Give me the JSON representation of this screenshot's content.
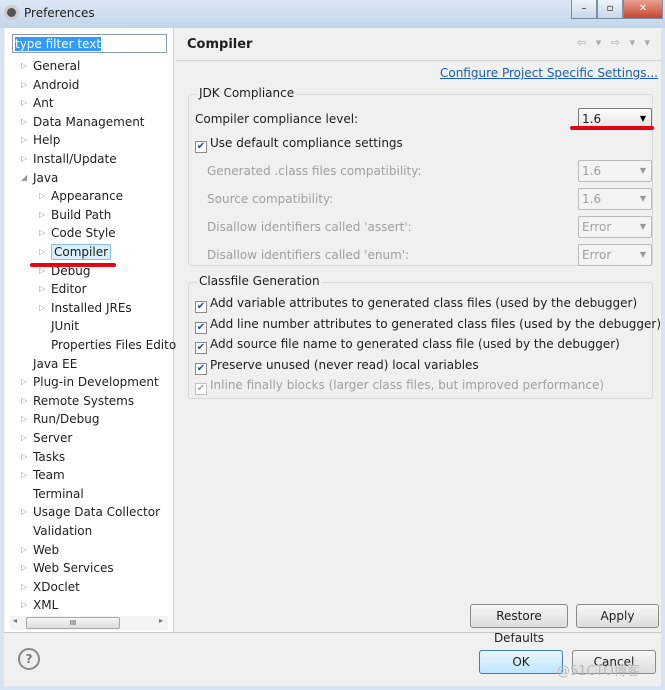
{
  "window": {
    "title": "Preferences",
    "min": "–",
    "max": "▫",
    "close": "✕"
  },
  "filter": {
    "value": "type filter text"
  },
  "tree": [
    {
      "label": "General",
      "level": 0,
      "arrow": true
    },
    {
      "label": "Android",
      "level": 0,
      "arrow": true
    },
    {
      "label": "Ant",
      "level": 0,
      "arrow": true
    },
    {
      "label": "Data Management",
      "level": 0,
      "arrow": true
    },
    {
      "label": "Help",
      "level": 0,
      "arrow": true
    },
    {
      "label": "Install/Update",
      "level": 0,
      "arrow": true
    },
    {
      "label": "Java",
      "level": 0,
      "arrow": true,
      "expanded": true
    },
    {
      "label": "Appearance",
      "level": 1,
      "arrow": true
    },
    {
      "label": "Build Path",
      "level": 1,
      "arrow": true
    },
    {
      "label": "Code Style",
      "level": 1,
      "arrow": true
    },
    {
      "label": "Compiler",
      "level": 1,
      "arrow": true,
      "selected": true
    },
    {
      "label": "Debug",
      "level": 1,
      "arrow": true
    },
    {
      "label": "Editor",
      "level": 1,
      "arrow": true
    },
    {
      "label": "Installed JREs",
      "level": 1,
      "arrow": true
    },
    {
      "label": "JUnit",
      "level": 1,
      "arrow": false
    },
    {
      "label": "Properties Files Edito",
      "level": 1,
      "arrow": false
    },
    {
      "label": "Java EE",
      "level": 0,
      "arrow": false
    },
    {
      "label": "Plug-in Development",
      "level": 0,
      "arrow": true
    },
    {
      "label": "Remote Systems",
      "level": 0,
      "arrow": true
    },
    {
      "label": "Run/Debug",
      "level": 0,
      "arrow": true
    },
    {
      "label": "Server",
      "level": 0,
      "arrow": true
    },
    {
      "label": "Tasks",
      "level": 0,
      "arrow": true
    },
    {
      "label": "Team",
      "level": 0,
      "arrow": true
    },
    {
      "label": "Terminal",
      "level": 0,
      "arrow": false
    },
    {
      "label": "Usage Data Collector",
      "level": 0,
      "arrow": true
    },
    {
      "label": "Validation",
      "level": 0,
      "arrow": false
    },
    {
      "label": "Web",
      "level": 0,
      "arrow": true
    },
    {
      "label": "Web Services",
      "level": 0,
      "arrow": true
    },
    {
      "label": "XDoclet",
      "level": 0,
      "arrow": true
    },
    {
      "label": "XML",
      "level": 0,
      "arrow": true
    }
  ],
  "scroll_thumb": "III",
  "page": {
    "title": "Compiler",
    "nav": "⇦ ▾ ⇨ ▾ ▾",
    "configure_link": "Configure Project Specific Settings..."
  },
  "jdk": {
    "title": "JDK Compliance",
    "level_label": "Compiler compliance level:",
    "level_value": "1.6",
    "use_default": "Use default compliance settings",
    "rows": [
      {
        "label": "Generated .class files compatibility:",
        "value": "1.6"
      },
      {
        "label": "Source compatibility:",
        "value": "1.6"
      },
      {
        "label": "Disallow identifiers called 'assert':",
        "value": "Error"
      },
      {
        "label": "Disallow identifiers called 'enum':",
        "value": "Error"
      }
    ]
  },
  "classfile": {
    "title": "Classfile Generation",
    "options": [
      {
        "label": "Add variable attributes to generated class files (used by the debugger)",
        "checked": true,
        "enabled": true
      },
      {
        "label": "Add line number attributes to generated class files (used by the debugger)",
        "checked": true,
        "enabled": true
      },
      {
        "label": "Add source file name to generated class file (used by the debugger)",
        "checked": true,
        "enabled": true
      },
      {
        "label": "Preserve unused (never read) local variables",
        "checked": true,
        "enabled": true
      },
      {
        "label": "Inline finally blocks (larger class files, but improved performance)",
        "checked": true,
        "enabled": false
      }
    ]
  },
  "buttons": {
    "restore": "Restore Defaults",
    "apply": "Apply",
    "ok": "OK",
    "cancel": "Cancel",
    "help": "?"
  },
  "watermark": "@51CTO博客"
}
